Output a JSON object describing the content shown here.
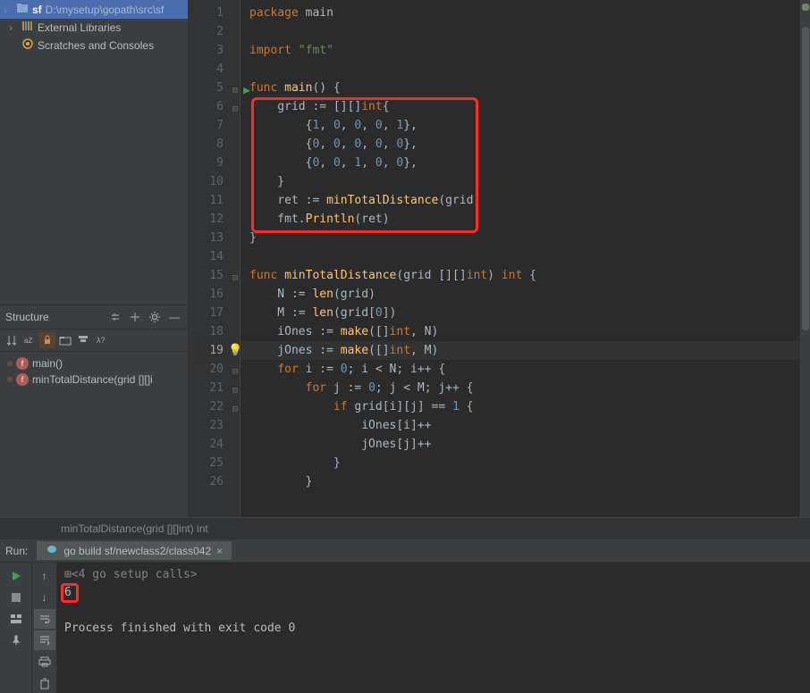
{
  "project": {
    "root_name": "sf",
    "root_path": "D:\\mysetup\\gopath\\src\\sf",
    "external_libs": "External Libraries",
    "scratches": "Scratches and Consoles"
  },
  "structure": {
    "title": "Structure",
    "items": [
      {
        "label": "main()"
      },
      {
        "label": "minTotalDistance(grid [][]i"
      }
    ]
  },
  "code": {
    "lines": [
      {
        "n": 1,
        "tokens": [
          [
            "kw",
            "package "
          ],
          [
            "pl",
            "main"
          ]
        ]
      },
      {
        "n": 2,
        "tokens": []
      },
      {
        "n": 3,
        "tokens": [
          [
            "kw",
            "import "
          ],
          [
            "str",
            "\"fmt\""
          ]
        ]
      },
      {
        "n": 4,
        "tokens": []
      },
      {
        "n": 5,
        "tokens": [
          [
            "kw",
            "func "
          ],
          [
            "fn",
            "main"
          ],
          [
            "pl",
            "() {"
          ]
        ],
        "run": true,
        "fold": true
      },
      {
        "n": 6,
        "tokens": [
          [
            "pl",
            "    grid := [][]"
          ],
          [
            "ty",
            "int"
          ],
          [
            "pl",
            "{"
          ]
        ],
        "fold": true
      },
      {
        "n": 7,
        "tokens": [
          [
            "pl",
            "        {"
          ],
          [
            "num",
            "1"
          ],
          [
            "pl",
            ", "
          ],
          [
            "num",
            "0"
          ],
          [
            "pl",
            ", "
          ],
          [
            "num",
            "0"
          ],
          [
            "pl",
            ", "
          ],
          [
            "num",
            "0"
          ],
          [
            "pl",
            ", "
          ],
          [
            "num",
            "1"
          ],
          [
            "pl",
            "},"
          ]
        ]
      },
      {
        "n": 8,
        "tokens": [
          [
            "pl",
            "        {"
          ],
          [
            "num",
            "0"
          ],
          [
            "pl",
            ", "
          ],
          [
            "num",
            "0"
          ],
          [
            "pl",
            ", "
          ],
          [
            "num",
            "0"
          ],
          [
            "pl",
            ", "
          ],
          [
            "num",
            "0"
          ],
          [
            "pl",
            ", "
          ],
          [
            "num",
            "0"
          ],
          [
            "pl",
            "},"
          ]
        ]
      },
      {
        "n": 9,
        "tokens": [
          [
            "pl",
            "        {"
          ],
          [
            "num",
            "0"
          ],
          [
            "pl",
            ", "
          ],
          [
            "num",
            "0"
          ],
          [
            "pl",
            ", "
          ],
          [
            "num",
            "1"
          ],
          [
            "pl",
            ", "
          ],
          [
            "num",
            "0"
          ],
          [
            "pl",
            ", "
          ],
          [
            "num",
            "0"
          ],
          [
            "pl",
            "},"
          ]
        ]
      },
      {
        "n": 10,
        "tokens": [
          [
            "pl",
            "    }"
          ]
        ]
      },
      {
        "n": 11,
        "tokens": [
          [
            "pl",
            "    ret := "
          ],
          [
            "fn",
            "minTotalDistance"
          ],
          [
            "pl",
            "(grid)"
          ]
        ]
      },
      {
        "n": 12,
        "tokens": [
          [
            "pl",
            "    fmt."
          ],
          [
            "fn",
            "Println"
          ],
          [
            "pl",
            "(ret)"
          ]
        ]
      },
      {
        "n": 13,
        "tokens": [
          [
            "pl",
            "}"
          ]
        ]
      },
      {
        "n": 14,
        "tokens": []
      },
      {
        "n": 15,
        "tokens": [
          [
            "kw",
            "func "
          ],
          [
            "fn",
            "minTotalDistance"
          ],
          [
            "pl",
            "(grid [][]"
          ],
          [
            "ty",
            "int"
          ],
          [
            "pl",
            ") "
          ],
          [
            "ty",
            "int"
          ],
          [
            "pl",
            " {"
          ]
        ],
        "fold": true
      },
      {
        "n": 16,
        "tokens": [
          [
            "pl",
            "    N := "
          ],
          [
            "fn",
            "len"
          ],
          [
            "pl",
            "(grid)"
          ]
        ]
      },
      {
        "n": 17,
        "tokens": [
          [
            "pl",
            "    M := "
          ],
          [
            "fn",
            "len"
          ],
          [
            "pl",
            "(grid["
          ],
          [
            "num",
            "0"
          ],
          [
            "pl",
            "])"
          ]
        ]
      },
      {
        "n": 18,
        "tokens": [
          [
            "pl",
            "    iOnes := "
          ],
          [
            "fn",
            "make"
          ],
          [
            "pl",
            "([]"
          ],
          [
            "ty",
            "int"
          ],
          [
            "pl",
            ", N)"
          ]
        ]
      },
      {
        "n": 19,
        "tokens": [
          [
            "pl",
            "    jOnes := "
          ],
          [
            "fn",
            "make"
          ],
          [
            "pl",
            "([]"
          ],
          [
            "ty",
            "int"
          ],
          [
            "pl",
            ", M)"
          ]
        ],
        "current": true,
        "bulb": true
      },
      {
        "n": 20,
        "tokens": [
          [
            "pl",
            "    "
          ],
          [
            "kw",
            "for"
          ],
          [
            "pl",
            " i := "
          ],
          [
            "num",
            "0"
          ],
          [
            "pl",
            "; i < N; i++ {"
          ]
        ],
        "fold": true
      },
      {
        "n": 21,
        "tokens": [
          [
            "pl",
            "        "
          ],
          [
            "kw",
            "for"
          ],
          [
            "pl",
            " j := "
          ],
          [
            "num",
            "0"
          ],
          [
            "pl",
            "; j < M; j++ {"
          ]
        ],
        "fold": true
      },
      {
        "n": 22,
        "tokens": [
          [
            "pl",
            "            "
          ],
          [
            "kw",
            "if"
          ],
          [
            "pl",
            " grid[i][j] == "
          ],
          [
            "num",
            "1"
          ],
          [
            "pl",
            " {"
          ]
        ],
        "fold": true
      },
      {
        "n": 23,
        "tokens": [
          [
            "pl",
            "                iOnes[i]++"
          ]
        ]
      },
      {
        "n": 24,
        "tokens": [
          [
            "pl",
            "                jOnes[j]++"
          ]
        ]
      },
      {
        "n": 25,
        "tokens": [
          [
            "pl",
            "            }"
          ]
        ]
      },
      {
        "n": 26,
        "tokens": [
          [
            "pl",
            "        }"
          ]
        ]
      }
    ]
  },
  "breadcrumb": "minTotalDistance(grid [][]int) int",
  "run": {
    "label": "Run:",
    "tab": "go build sf/newclass2/class042",
    "console": [
      "<4 go setup calls>",
      "6",
      "",
      "Process finished with exit code 0"
    ]
  }
}
